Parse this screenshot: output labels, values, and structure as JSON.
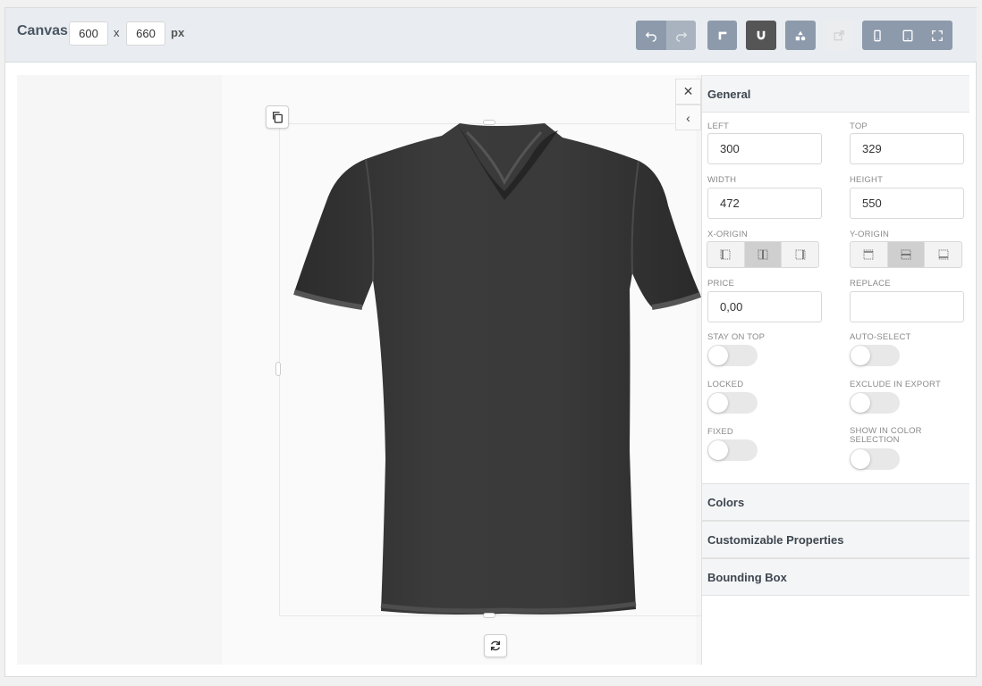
{
  "header": {
    "canvas_label": "Canvas",
    "width_value": "600",
    "times": "x",
    "height_value": "660",
    "unit": "px",
    "toolbar_icons": [
      "undo-icon",
      "redo-icon",
      "ruler-icon",
      "magnet-icon",
      "shapes-icon",
      "export-icon",
      "mobile-icon",
      "tablet-icon",
      "fullscreen-icon"
    ]
  },
  "panel": {
    "general": {
      "title": "General",
      "left_label": "LEFT",
      "left_value": "300",
      "top_label": "TOP",
      "top_value": "329",
      "width_label": "WIDTH",
      "width_value": "472",
      "height_label": "HEIGHT",
      "height_value": "550",
      "x_origin_label": "X-ORIGIN",
      "x_origin_selected": "center",
      "y_origin_label": "Y-ORIGIN",
      "y_origin_selected": "center",
      "price_label": "PRICE",
      "price_value": "0,00",
      "replace_label": "REPLACE",
      "replace_value": "",
      "stay_on_top_label": "STAY ON TOP",
      "auto_select_label": "AUTO-SELECT",
      "locked_label": "LOCKED",
      "exclude_export_label": "EXCLUDE IN EXPORT",
      "fixed_label": "FIXED",
      "show_color_label": "SHOW IN COLOR SELECTION"
    },
    "colors_title": "Colors",
    "customizable_title": "Customizable Properties",
    "bounding_box_title": "Bounding Box"
  },
  "colors": {
    "toolbar": "#8d9aab",
    "toolbar_dark": "#555555",
    "shirt": "#3a3a3a"
  }
}
